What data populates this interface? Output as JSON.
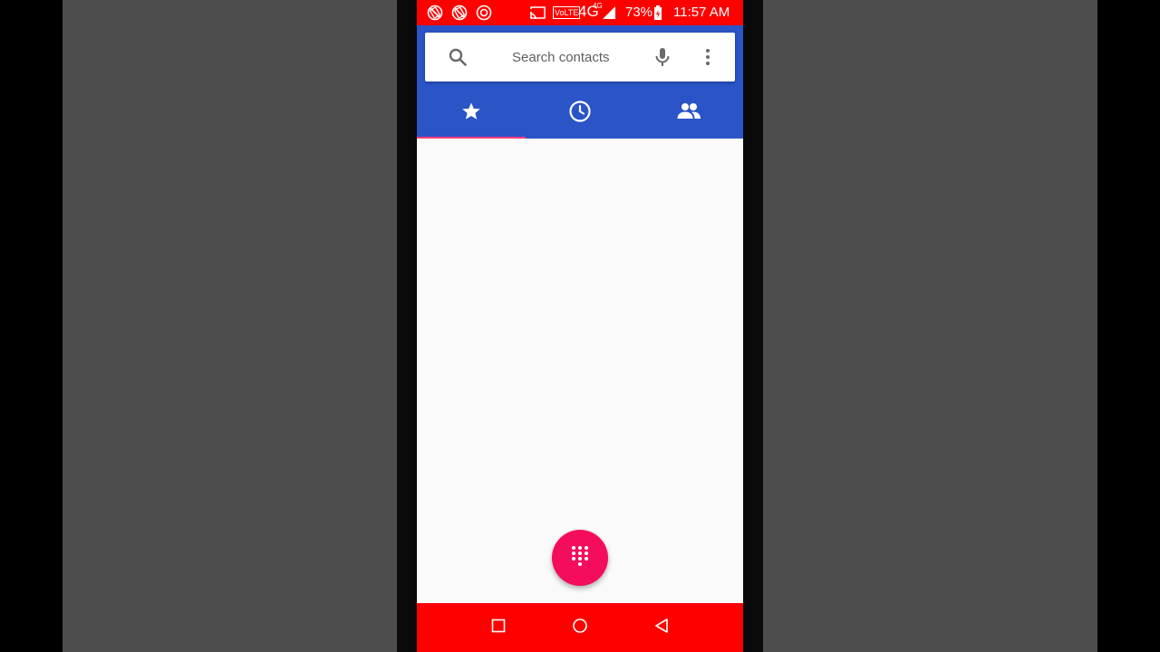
{
  "status_bar": {
    "network": "4G",
    "network_small": "4G",
    "volte": "VoLTE",
    "battery": "73%",
    "time": "11:57 AM",
    "icons": [
      "blocked-notification-icon",
      "blocked-notification-icon",
      "sync-icon",
      "cast-icon",
      "volte-icon",
      "signal-icon",
      "battery-charging-icon"
    ]
  },
  "search": {
    "placeholder": "Search contacts",
    "value": ""
  },
  "tabs": [
    {
      "name": "favorites",
      "icon": "star-icon",
      "selected": true
    },
    {
      "name": "recents",
      "icon": "clock-icon",
      "selected": false
    },
    {
      "name": "contacts",
      "icon": "people-icon",
      "selected": false
    }
  ],
  "fab": {
    "icon": "dialpad-icon"
  },
  "nav": {
    "buttons": [
      "recents-square-icon",
      "home-circle-icon",
      "back-triangle-icon"
    ]
  },
  "colors": {
    "status_bar": "#ff0000",
    "app_bar": "#2b54c7",
    "tab_indicator": "#ff3b7f",
    "fab": "#f50d5d",
    "nav_bar": "#ff0000"
  }
}
